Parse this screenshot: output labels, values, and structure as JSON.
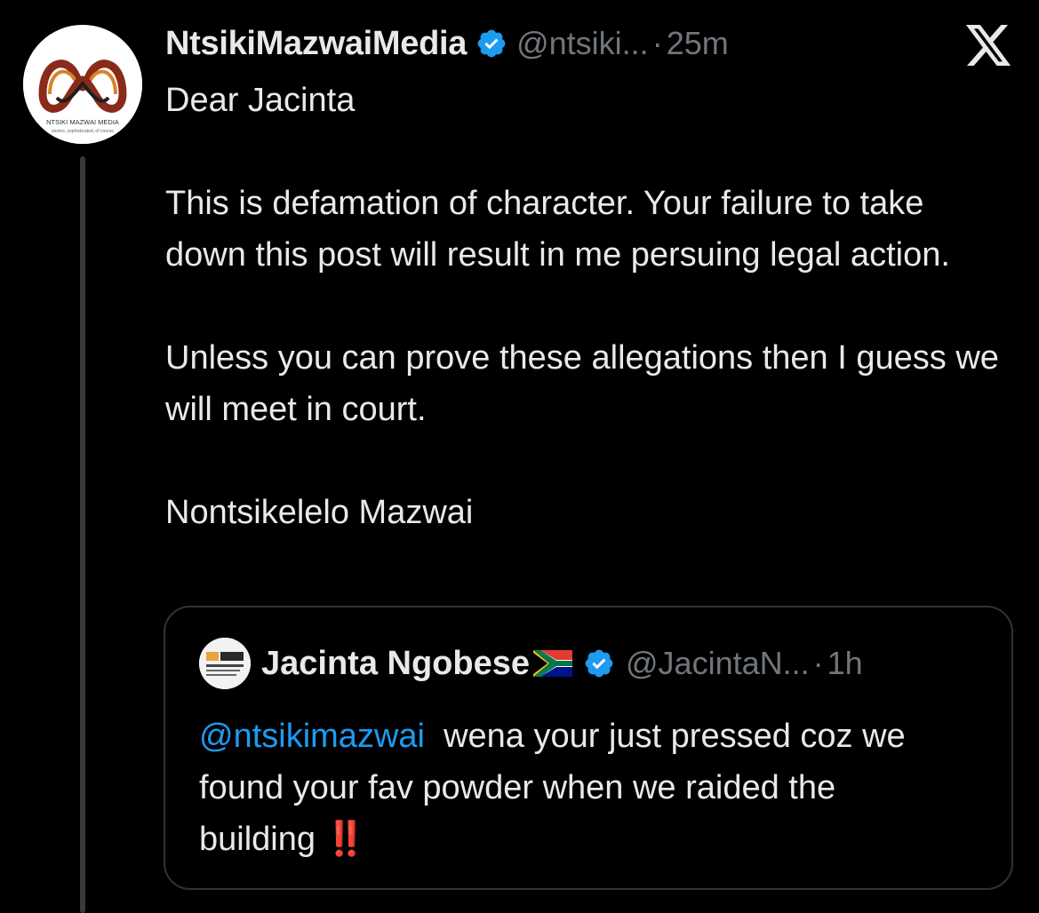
{
  "tweet": {
    "display_name": "NtsikiMazwaiMedia",
    "handle": "@ntsiki...",
    "separator": "·",
    "time": "25m",
    "avatar_logo_text": "NTSIKI MAZWAI MEDIA",
    "avatar_tagline": "stories, sophisticated, of course",
    "verified_icon": "verified-badge-icon",
    "close_icon": "x-logo-icon",
    "body": {
      "line1": "Dear Jacinta",
      "para2": "This is defamation of character. Your failure to take down this post will result in me persuing legal action.",
      "para3": "Unless you can prove these allegations then I guess we will meet in court.",
      "para4": "Nontsikelelo Mazwai"
    }
  },
  "quoted_tweet": {
    "display_name": "Jacinta Ngobese",
    "flag_icon": "south-africa-flag-icon",
    "handle": "@JacintaN...",
    "separator": "·",
    "time": "1h",
    "mention": "@ntsikimazwai",
    "body_text": "wena your just pressed coz we found your fav powder when we raided the building",
    "emphasis": "‼️"
  },
  "colors": {
    "background": "#000000",
    "text": "#e7e9ea",
    "muted": "#71767b",
    "link": "#1d9bf0",
    "verified": "#1d9bf0",
    "border": "#2f3336",
    "emphasis": "#e0241a"
  }
}
